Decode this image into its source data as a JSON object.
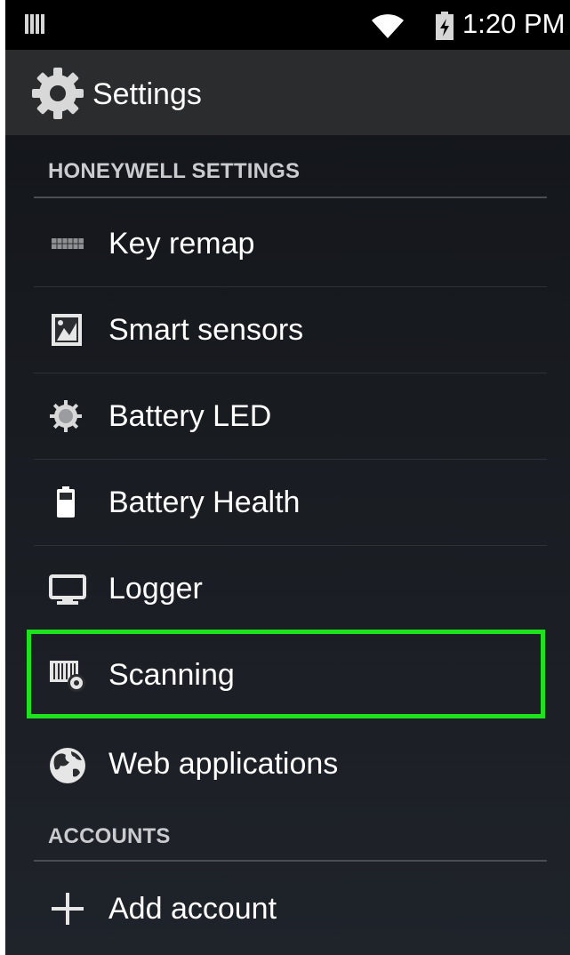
{
  "status_bar": {
    "time": "1:20 PM",
    "icons": [
      "notification-icon",
      "wifi-icon",
      "battery-charging-icon"
    ]
  },
  "action_bar": {
    "title": "Settings",
    "icon": "settings-gear-icon"
  },
  "sections": [
    {
      "header": "HONEYWELL SETTINGS",
      "items": [
        {
          "label": "Key remap",
          "icon": "keyboard-icon"
        },
        {
          "label": "Smart sensors",
          "icon": "smart-sensor-icon"
        },
        {
          "label": "Battery LED",
          "icon": "led-icon"
        },
        {
          "label": "Battery Health",
          "icon": "battery-icon"
        },
        {
          "label": "Logger",
          "icon": "monitor-icon"
        },
        {
          "label": "Scanning",
          "icon": "scanner-settings-icon",
          "highlighted": true
        },
        {
          "label": "Web applications",
          "icon": "globe-icon"
        }
      ]
    },
    {
      "header": "ACCOUNTS",
      "items": [
        {
          "label": "Add account",
          "icon": "plus-icon"
        }
      ]
    }
  ],
  "colors": {
    "highlight_border": "#1fe21f",
    "status_bar": "#000000",
    "action_bar": "#2b2c2e",
    "background": "#181b20"
  }
}
